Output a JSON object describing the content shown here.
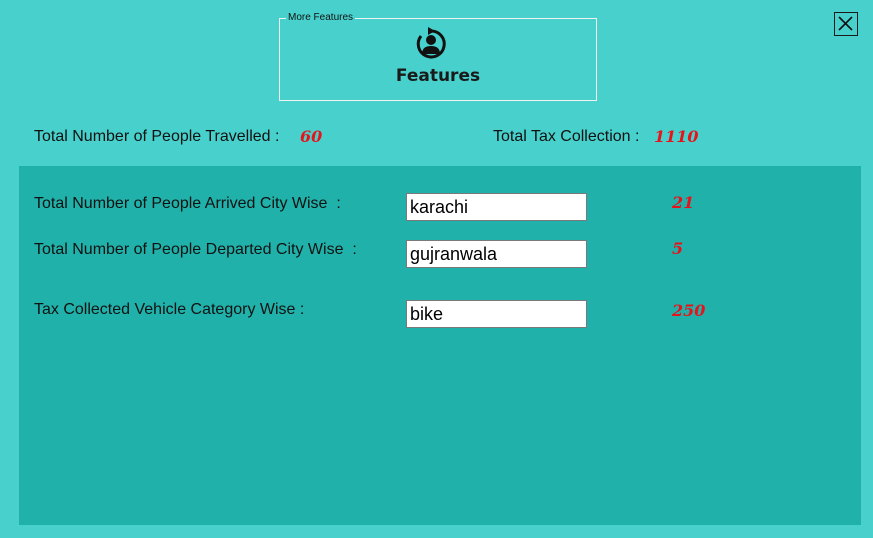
{
  "features_group": {
    "legend": "More Features",
    "title": "Features",
    "icon": "user-refresh-icon"
  },
  "close_icon": "close-icon",
  "summary": {
    "people_travelled_label": "Total Number of People Travelled :",
    "people_travelled_value": "60",
    "tax_collection_label": "Total Tax Collection :",
    "tax_collection_value": "1110"
  },
  "details": {
    "arrived": {
      "label": "Total Number of People Arrived City Wise  :",
      "input_value": "karachi",
      "result": "21"
    },
    "departed": {
      "label": "Total Number of People Departed City Wise  :",
      "input_value": "gujranwala",
      "result": "5"
    },
    "vehicle_tax": {
      "label": "Tax Collected Vehicle Category Wise :",
      "input_value": "bike",
      "result": "250"
    }
  },
  "colors": {
    "background": "#48d1cc",
    "panel": "#20b2aa",
    "value_text": "#e8131a"
  }
}
